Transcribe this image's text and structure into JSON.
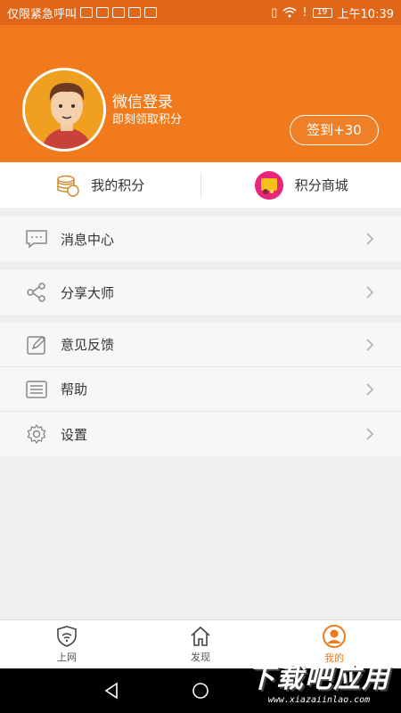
{
  "status_bar": {
    "carrier": "仅限紧急呼叫",
    "battery": "19",
    "time": "上午10:39"
  },
  "header": {
    "login_title": "微信登录",
    "login_subtitle": "即刻领取积分",
    "checkin_label": "签到+30"
  },
  "points_bar": {
    "my_points_label": "我的积分",
    "points_mall_label": "积分商城"
  },
  "menu": {
    "group1": [
      {
        "label": "消息中心",
        "icon": "message-icon"
      }
    ],
    "group2": [
      {
        "label": "分享大师",
        "icon": "share-icon"
      }
    ],
    "group3": [
      {
        "label": "意见反馈",
        "icon": "feedback-icon"
      },
      {
        "label": "帮助",
        "icon": "help-list-icon"
      },
      {
        "label": "设置",
        "icon": "settings-gear-icon"
      }
    ]
  },
  "bottom_nav": {
    "items": [
      {
        "label": "上网",
        "icon": "shield-wifi-icon",
        "active": false
      },
      {
        "label": "发现",
        "icon": "home-icon",
        "active": false
      },
      {
        "label": "我的",
        "icon": "user-icon",
        "active": true
      }
    ]
  },
  "watermark": {
    "title": "下载吧应用",
    "url": "www.xiazaiinlao.com"
  },
  "colors": {
    "accent": "#f07a1c",
    "status_bar": "#e0661a"
  }
}
